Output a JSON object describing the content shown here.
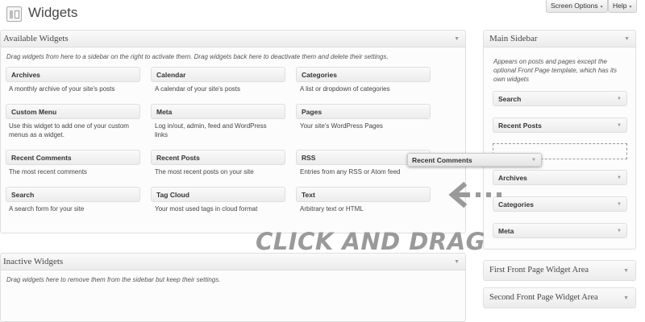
{
  "header": {
    "title": "Widgets",
    "screen_options": "Screen Options",
    "help": "Help",
    "dropdown_icon": "▾"
  },
  "available": {
    "title": "Available Widgets",
    "description": "Drag widgets from here to a sidebar on the right to activate them. Drag widgets back here to deactivate them and delete their settings.",
    "widgets": [
      {
        "name": "Archives",
        "desc": "A monthly archive of your site's posts"
      },
      {
        "name": "Calendar",
        "desc": "A calendar of your site's posts"
      },
      {
        "name": "Categories",
        "desc": "A list or dropdown of categories"
      },
      {
        "name": "Custom Menu",
        "desc": "Use this widget to add one of your custom menus as a widget."
      },
      {
        "name": "Meta",
        "desc": "Log in/out, admin, feed and WordPress links"
      },
      {
        "name": "Pages",
        "desc": "Your site's WordPress Pages"
      },
      {
        "name": "Recent Comments",
        "desc": "The most recent comments"
      },
      {
        "name": "Recent Posts",
        "desc": "The most recent posts on your site"
      },
      {
        "name": "RSS",
        "desc": "Entries from any RSS or Atom feed"
      },
      {
        "name": "Search",
        "desc": "A search form for your site"
      },
      {
        "name": "Tag Cloud",
        "desc": "Your most used tags in cloud format"
      },
      {
        "name": "Text",
        "desc": "Arbitrary text or HTML"
      }
    ]
  },
  "inactive": {
    "title": "Inactive Widgets",
    "description": "Drag widgets here to remove them from the sidebar but keep their settings."
  },
  "sidebar": {
    "title": "Main Sidebar",
    "description": "Appears on posts and pages except the optional Front Page template, which has its own widgets",
    "widgets": [
      "Search",
      "Recent Posts",
      "Archives",
      "Categories",
      "Meta"
    ]
  },
  "dragging_widget": "Recent Comments",
  "overlay_text": "CLICK AND DRAG",
  "areas": [
    "First Front Page Widget Area",
    "Second Front Page Widget Area"
  ],
  "colors": {
    "overlay": "#9a9a9a",
    "panel_border": "#dfdfdf"
  }
}
